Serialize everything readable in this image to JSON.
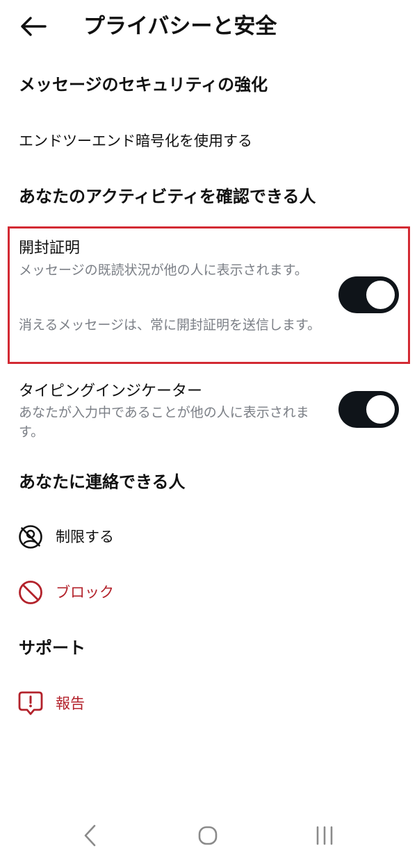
{
  "header": {
    "title": "プライバシーと安全",
    "back_icon": "arrow-left-icon"
  },
  "sections": {
    "message_security": {
      "heading": "メッセージのセキュリティの強化",
      "e2e_label": "エンドツーエンド暗号化を使用する"
    },
    "activity": {
      "heading": "あなたのアクティビティを確認できる人",
      "read_receipts": {
        "title": "開封証明",
        "description_1": "メッセージの既読状況が他の人に表示されます。",
        "description_2": "消えるメッセージは、常に開封証明を送信します。",
        "enabled": true
      },
      "typing_indicator": {
        "title": "タイピングインジケーター",
        "description": "あなたが入力中であることが他の人に表示されます。",
        "enabled": true
      }
    },
    "contact": {
      "heading": "あなたに連絡できる人",
      "restrict_label": "制限する",
      "restrict_icon": "restrict-icon",
      "block_label": "ブロック",
      "block_icon": "block-icon"
    },
    "support": {
      "heading": "サポート",
      "report_label": "報告",
      "report_icon": "report-icon"
    }
  },
  "nav": {
    "back_icon": "nav-back-icon",
    "home_icon": "nav-home-icon",
    "recents_icon": "nav-recents-icon"
  },
  "colors": {
    "toggle_on": "#0f1419",
    "danger": "#b3222b",
    "highlight_border": "#d32a33",
    "secondary_text": "#7b7f86"
  }
}
